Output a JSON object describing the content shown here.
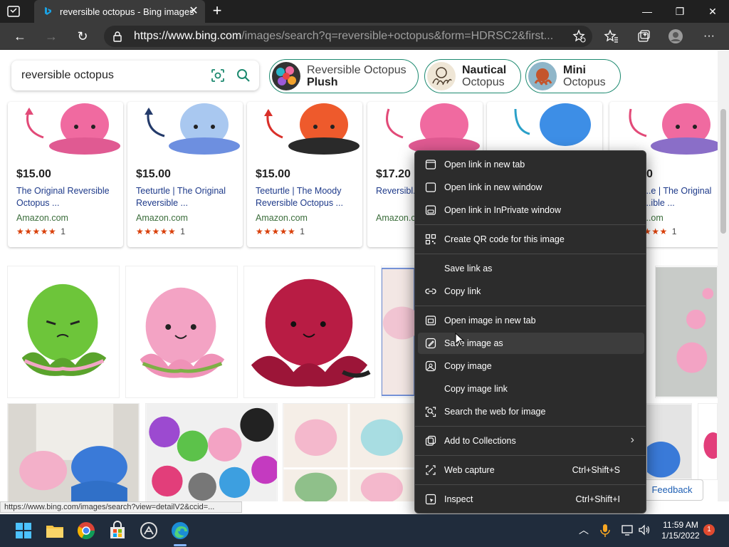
{
  "browser": {
    "tab_title": "reversible octopus - Bing images",
    "url_host": "https://www.bing.com",
    "url_path": "/images/search?q=reversible+octopus&form=HDRSC2&first..."
  },
  "search": {
    "query": "reversible octopus"
  },
  "chips": [
    {
      "line1": "Reversible Octopus",
      "line2": "Plush",
      "bold_line": 2
    },
    {
      "line1": "Nautical",
      "line2": "Octopus",
      "bold_line": 1
    },
    {
      "line1": "Mini",
      "line2": "Octopus",
      "bold_line": 1
    }
  ],
  "products": [
    {
      "price": "$15.00",
      "title": "The Original Reversible Octopus ...",
      "source": "Amazon.com",
      "stars": "★★★★★",
      "reviews": "1",
      "color": "#f06aa0"
    },
    {
      "price": "$15.00",
      "title": "Teeturtle | The Original Reversible ...",
      "source": "Amazon.com",
      "stars": "★★★★★",
      "reviews": "1",
      "color": "#6d8fe0"
    },
    {
      "price": "$15.00",
      "title": "Teeturtle | The Moody Reversible Octopus ...",
      "source": "Amazon.com",
      "stars": "★★★★★",
      "reviews": "1",
      "color": "#e9462a"
    },
    {
      "price": "$17.20",
      "title": "Reversibl... Mini Plus...",
      "source": "Amazon.c",
      "stars": "",
      "reviews": "",
      "color": "#f06aa0"
    },
    {
      "price": "",
      "title": "",
      "source": "",
      "stars": "",
      "reviews": "",
      "color": "#3d8ee6"
    },
    {
      "price": "0",
      "title": "...e | The Original ...ible ...",
      "source": "...om",
      "stars": "★★★",
      "reviews": "1",
      "color": "#f06aa0"
    }
  ],
  "context_menu": {
    "items": [
      {
        "label": "Open link in new tab",
        "icon": "new-tab-icon"
      },
      {
        "label": "Open link in new window",
        "icon": "new-window-icon"
      },
      {
        "label": "Open link in InPrivate window",
        "icon": "inprivate-icon"
      },
      {
        "label": "Create QR code for this image",
        "icon": "qr-code-icon"
      },
      {
        "label": "Save link as",
        "icon": ""
      },
      {
        "label": "Copy link",
        "icon": "link-icon"
      },
      {
        "label": "Open image in new tab",
        "icon": "image-tab-icon"
      },
      {
        "label": "Save image as",
        "icon": "save-image-icon"
      },
      {
        "label": "Copy image",
        "icon": "copy-image-icon"
      },
      {
        "label": "Copy image link",
        "icon": ""
      },
      {
        "label": "Search the web for image",
        "icon": "image-search-icon"
      },
      {
        "label": "Add to Collections",
        "icon": "collections-icon"
      },
      {
        "label": "Web capture",
        "icon": "web-capture-icon",
        "shortcut": "Ctrl+Shift+S"
      },
      {
        "label": "Inspect",
        "icon": "inspect-icon",
        "shortcut": "Ctrl+Shift+I"
      }
    ]
  },
  "status_url": "https://www.bing.com/images/search?view=detailV2&ccid=...",
  "feedback_label": "Feedback",
  "taskbar": {
    "time": "11:59 AM",
    "date": "1/15/2022",
    "notification_count": "1"
  }
}
